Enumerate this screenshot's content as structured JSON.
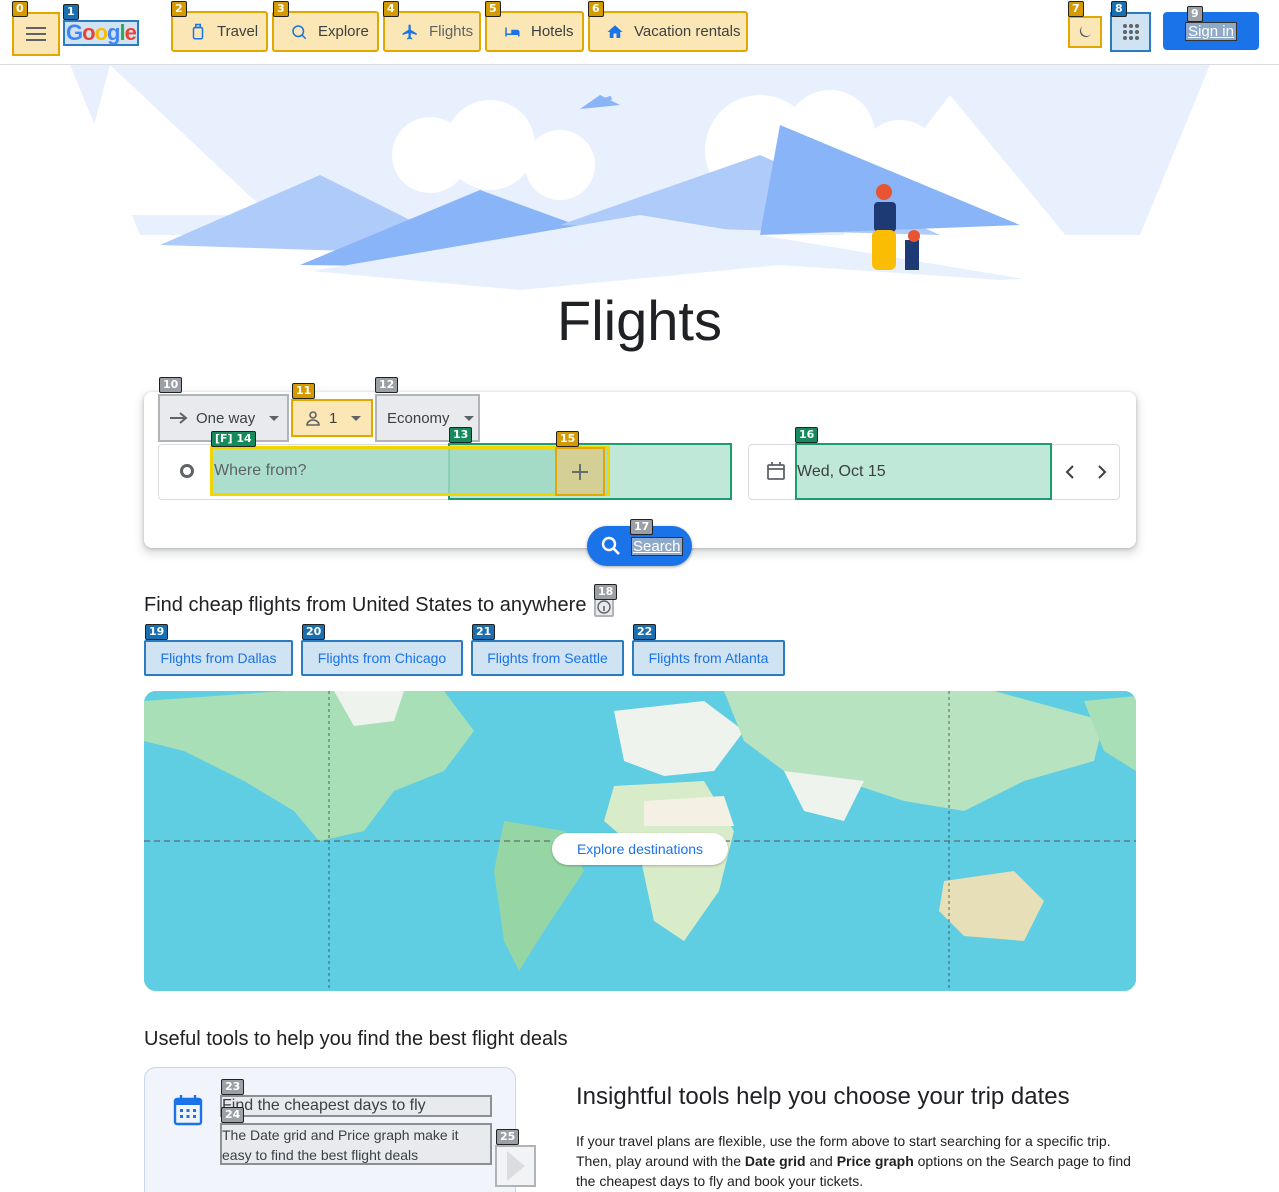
{
  "header": {
    "logo_text": "Google",
    "tabs": [
      {
        "label": "Travel"
      },
      {
        "label": "Explore"
      },
      {
        "label": "Flights"
      },
      {
        "label": "Hotels"
      },
      {
        "label": "Vacation rentals"
      }
    ],
    "sign_in": "Sign in"
  },
  "hero": {
    "title": "Flights"
  },
  "search": {
    "trip_type": "One way",
    "passengers": "1",
    "cabin_class": "Economy",
    "from_placeholder": "Where from?",
    "date": "Wed, Oct 15",
    "search_label": "Search"
  },
  "cheap_flights": {
    "title": "Find cheap flights from United States to anywhere",
    "chips": [
      {
        "label": "Flights from Dallas"
      },
      {
        "label": "Flights from Chicago"
      },
      {
        "label": "Flights from Seattle"
      },
      {
        "label": "Flights from Atlanta"
      }
    ],
    "explore_label": "Explore destinations"
  },
  "tools": {
    "title": "Useful tools to help you find the best flight deals",
    "card_title": "Find the cheapest days to fly",
    "card_desc": "The Date grid and Price graph make it easy to find the best flight deals",
    "insight_heading": "Insightful tools help you choose your trip dates",
    "insight_p1": "If your travel plans are flexible, use the form above to start searching for a specific trip. Then, play around with the ",
    "insight_b1": "Date grid",
    "insight_p2": " and ",
    "insight_b2": "Price graph",
    "insight_p3": " options on the Search page to find the cheapest days to fly and book your tickets."
  },
  "marks": [
    "0",
    "1",
    "2",
    "3",
    "4",
    "5",
    "6",
    "7",
    "8",
    "9",
    "10",
    "11",
    "12",
    "13",
    "[F] 14",
    "15",
    "16",
    "17",
    "18",
    "19",
    "20",
    "21",
    "22",
    "23",
    "24",
    "25"
  ],
  "colors": {
    "accent": "#1a73e8",
    "map_water": "#5fcde2",
    "hero_blue": "#aecbfa"
  }
}
